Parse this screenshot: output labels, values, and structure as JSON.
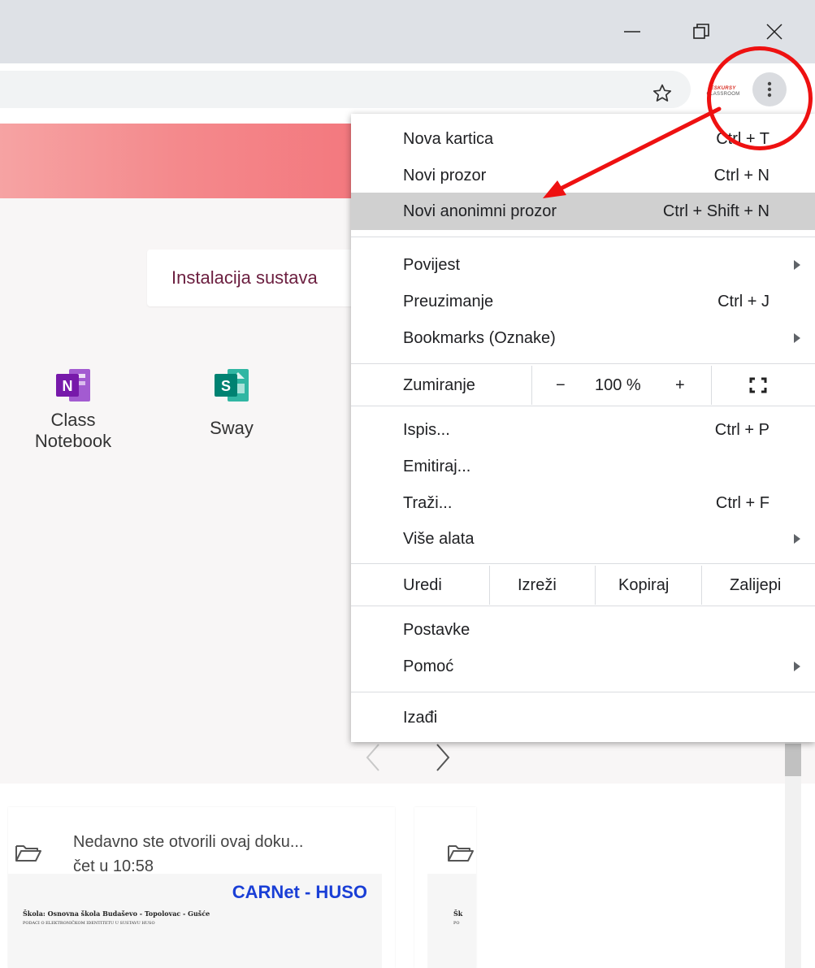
{
  "window": {
    "minimize_icon": "minimize-icon",
    "maximize_icon": "restore-icon",
    "close_icon": "close-icon"
  },
  "toolbar": {
    "star_icon": "star-outline-icon",
    "extension_logo_line1": "ESKURSY",
    "extension_logo_line2": "CLASSROOM",
    "menu_icon": "kebab-vertical-icon"
  },
  "page": {
    "install_card_text": "Instalacija sustava",
    "apps": [
      {
        "label_line1": "Class",
        "label_line2": "Notebook",
        "icon": "onenote-icon",
        "color": "#7719aa"
      },
      {
        "label": "Sway",
        "icon": "sway-icon",
        "color": "#008272"
      }
    ],
    "recent_file": {
      "line1": "Nedavno ste otvorili ovaj doku...",
      "line2": "čet u 10:58"
    },
    "preview": {
      "brand": "CARNet - HUSO",
      "line1": "Škola: Osnovna škola Budaševo - Topolovac - Gušće",
      "line2": "PODACI O ELEKTRONIČKOM IDENTITETU U SUSTAVU HUSO",
      "line1_short": "Šk",
      "line2_short": "PO"
    }
  },
  "menu": {
    "new_tab": {
      "label": "Nova kartica",
      "shortcut": "Ctrl + T"
    },
    "new_window": {
      "label": "Novi prozor",
      "shortcut": "Ctrl + N"
    },
    "new_incognito": {
      "label": "Novi anonimni prozor",
      "shortcut": "Ctrl + Shift + N"
    },
    "history": {
      "label": "Povijest"
    },
    "downloads": {
      "label": "Preuzimanje",
      "shortcut": "Ctrl + J"
    },
    "bookmarks": {
      "label": "Bookmarks (Oznake)"
    },
    "zoom": {
      "label": "Zumiranje",
      "minus": "−",
      "value": "100 %",
      "plus": "+"
    },
    "print": {
      "label": "Ispis...",
      "shortcut": "Ctrl + P"
    },
    "cast": {
      "label": "Emitiraj..."
    },
    "find": {
      "label": "Traži...",
      "shortcut": "Ctrl + F"
    },
    "more_tools": {
      "label": "Više alata"
    },
    "edit": {
      "label": "Uredi",
      "cut": "Izreži",
      "copy": "Kopiraj",
      "paste": "Zalijepi"
    },
    "settings": {
      "label": "Postavke"
    },
    "help": {
      "label": "Pomoć"
    },
    "exit": {
      "label": "Izađi"
    }
  },
  "annotation": {
    "color": "#ee1111"
  }
}
